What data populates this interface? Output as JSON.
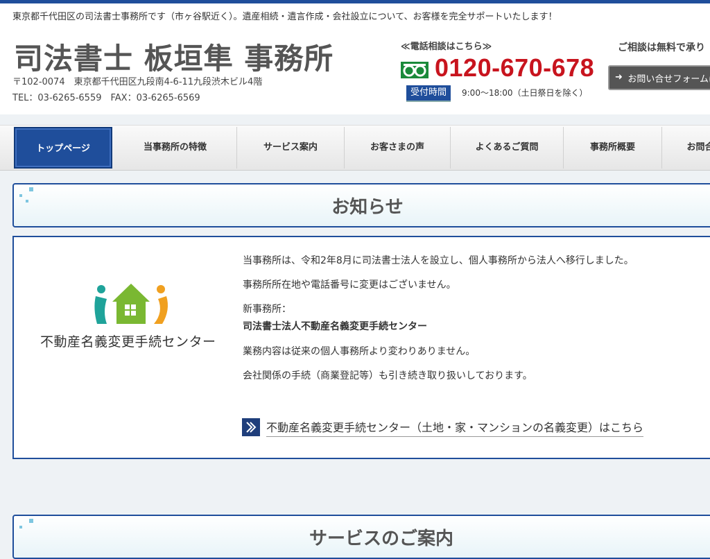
{
  "header": {
    "tagline": "東京都千代田区の司法書士事務所です（市ヶ谷駅近く）。遺産相続・遺言作成・会社設立について、お客様を完全サポートいたします！",
    "site_title": "司法書士 板垣隼 事務所",
    "address": "〒102-0074　東京都千代田区九段南4-6-11九段渋木ビル4階",
    "tel_fax": "TEL：03-6265-6559　FAX：03-6265-6569",
    "phone_label": "≪電話相談はこちら≫",
    "phone_number": "0120-670-678",
    "hours_badge": "受付時間",
    "hours_text": "9:00〜18:00（土日祭日を除く）",
    "free_consult": "ご相談は無料で承り",
    "contact_button": "お問い合せフォームは"
  },
  "nav": {
    "items": [
      {
        "label": "トップページ"
      },
      {
        "label": "当事務所の特徴"
      },
      {
        "label": "サービス案内"
      },
      {
        "label": "お客さまの声"
      },
      {
        "label": "よくあるご質問"
      },
      {
        "label": "事務所概要"
      },
      {
        "label": "お問合"
      }
    ]
  },
  "notice": {
    "title": "お知らせ",
    "logo_text": "不動産名義変更手続センター",
    "paragraphs": [
      "当事務所は、令和2年8月に司法書士法人を設立し、個人事務所から法人へ移行しました。",
      "事務所所在地や電話番号に変更はございません。",
      "新事務所：",
      "司法書士法人不動産名義変更手続センター",
      "業務内容は従来の個人事務所より変わりありません。",
      "会社関係の手続（商業登記等）も引き続き取り扱いしております。"
    ],
    "link_text": "不動産名義変更手続センター（土地・家・マンションの名義変更）はこちら"
  },
  "services": {
    "title": "サービスのご案内"
  },
  "colors": {
    "brand_blue": "#1f4e9b",
    "phone_red": "#c8141e",
    "logo_teal": "#1fa39a",
    "logo_green": "#7ab832",
    "logo_orange": "#f0a020"
  }
}
